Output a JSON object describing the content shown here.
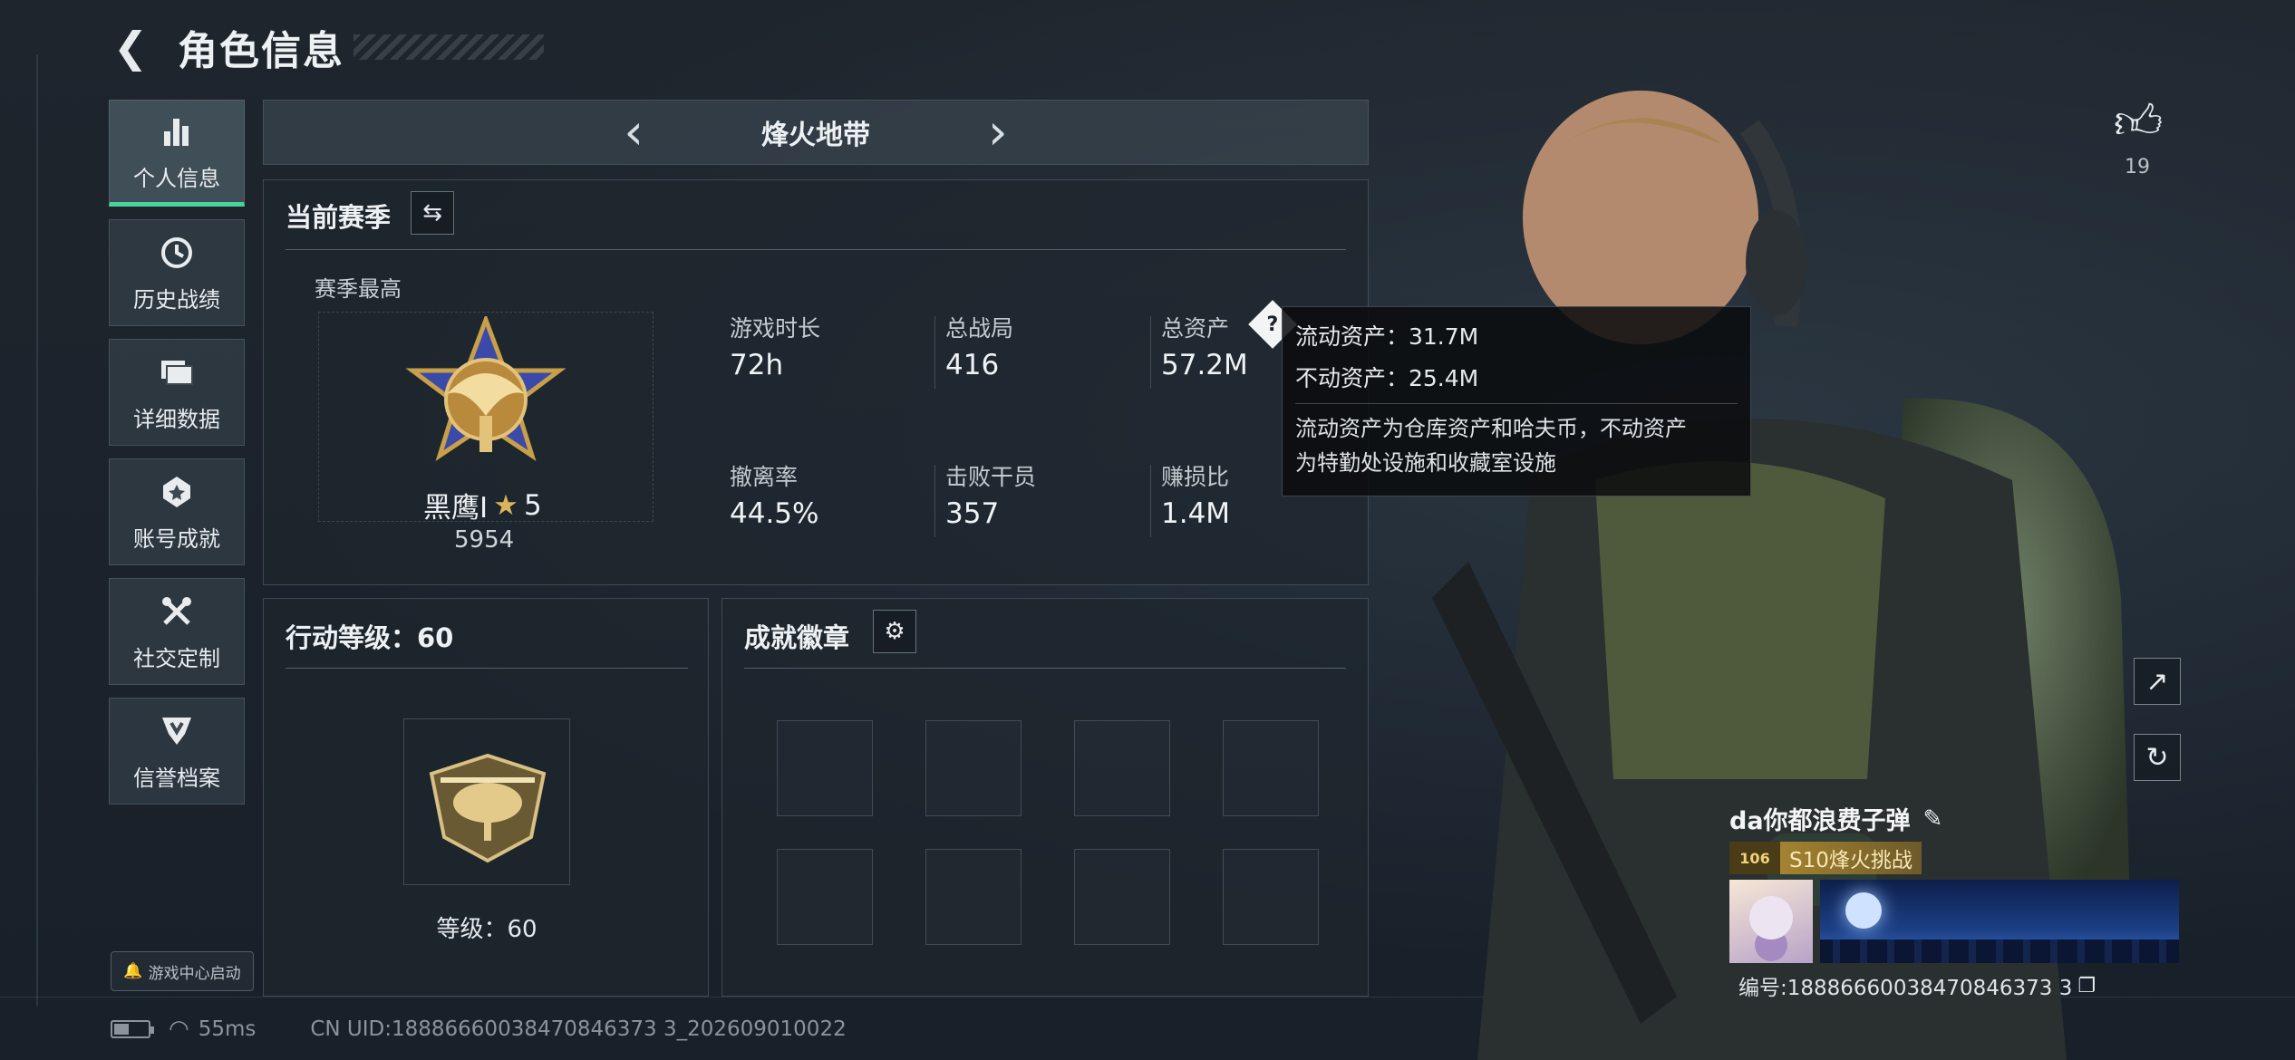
{
  "header": {
    "title": "角色信息"
  },
  "nav": [
    {
      "label": "个人信息",
      "icon": "bar-chart-icon",
      "active": true
    },
    {
      "label": "历史战绩",
      "icon": "history-clock-icon"
    },
    {
      "label": "详细数据",
      "icon": "folder-data-icon"
    },
    {
      "label": "账号成就",
      "icon": "achievement-icon"
    },
    {
      "label": "社交定制",
      "icon": "tools-icon"
    },
    {
      "label": "信誉档案",
      "icon": "credit-shield-icon"
    }
  ],
  "game_center": {
    "label": "游戏中心启动"
  },
  "status": {
    "ping": "55ms",
    "uid": "CN UID:18886660038470846373 3_202609010022"
  },
  "mode_bar": {
    "mode": "烽火地带"
  },
  "season": {
    "title": "当前赛季",
    "best_label": "赛季最高",
    "rank_name": "黑鹰I",
    "rank_stars": "5",
    "rank_score": "5954",
    "stats": [
      {
        "label": "游戏时长",
        "value": "72h"
      },
      {
        "label": "总战局",
        "value": "416"
      },
      {
        "label": "总资产",
        "value": "57.2M"
      },
      {
        "label": "撤离率",
        "value": "44.5%"
      },
      {
        "label": "击败干员",
        "value": "357"
      },
      {
        "label": "赚损比",
        "value": "1.4M"
      }
    ]
  },
  "tooltip": {
    "liquid": "流动资产：31.7M",
    "fixed": "不动资产：25.4M",
    "desc_line1": "流动资产为仓库资产和哈夫币，不动资产",
    "desc_line2": "为特勤处设施和收藏室设施"
  },
  "action_level": {
    "title": "行动等级：60",
    "level_text": "等级：60"
  },
  "achievements": {
    "title": "成就徽章"
  },
  "likes": {
    "count": "19"
  },
  "player": {
    "name": "da你都浪费子弹",
    "badge_level": "106",
    "badge_text": "S10烽火挑战",
    "id_text": "编号:18886660038470846373 3"
  },
  "colors": {
    "accent": "#49d29a",
    "bg": "#1b222a"
  }
}
